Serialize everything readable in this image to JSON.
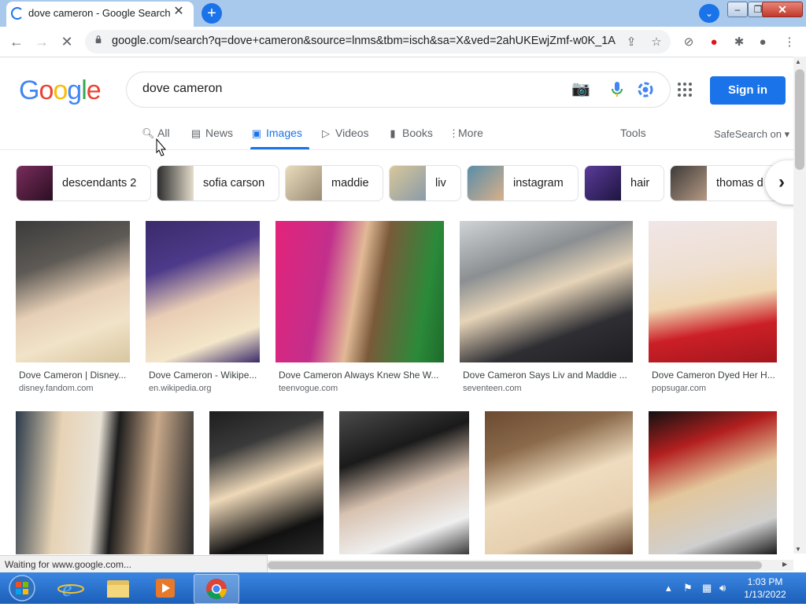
{
  "browser": {
    "tab_title": "dove cameron - Google Search",
    "url": "google.com/search?q=dove+cameron&source=lnms&tbm=isch&sa=X&ved=2ahUKEwjZmf-w0K_1Ah...",
    "status_text": "Waiting for www.google.com..."
  },
  "google": {
    "query": "dove cameron",
    "sign_in_label": "Sign in",
    "tabs": [
      {
        "label": "All"
      },
      {
        "label": "News"
      },
      {
        "label": "Images"
      },
      {
        "label": "Videos"
      },
      {
        "label": "Books"
      },
      {
        "label": "More"
      }
    ],
    "tools_label": "Tools",
    "safesearch_label": "SafeSearch on",
    "chips": [
      "descendants 2",
      "sofia carson",
      "maddie",
      "liv",
      "instagram",
      "hair",
      "thomas d"
    ],
    "results_row1": [
      {
        "title": "Dove Cameron | Disney...",
        "source": "disney.fandom.com"
      },
      {
        "title": "Dove Cameron - Wikipe...",
        "source": "en.wikipedia.org"
      },
      {
        "title": "Dove Cameron Always Knew She W...",
        "source": "teenvogue.com"
      },
      {
        "title": "Dove Cameron Says Liv and Maddie ...",
        "source": "seventeen.com"
      },
      {
        "title": "Dove Cameron Dyed Her H...",
        "source": "popsugar.com"
      }
    ]
  },
  "taskbar": {
    "time": "1:03 PM",
    "date": "1/13/2022"
  },
  "colors": {
    "accent": "#1a73e8",
    "titlebar": "#a9c9ec",
    "taskbar": "#2a72cc"
  }
}
